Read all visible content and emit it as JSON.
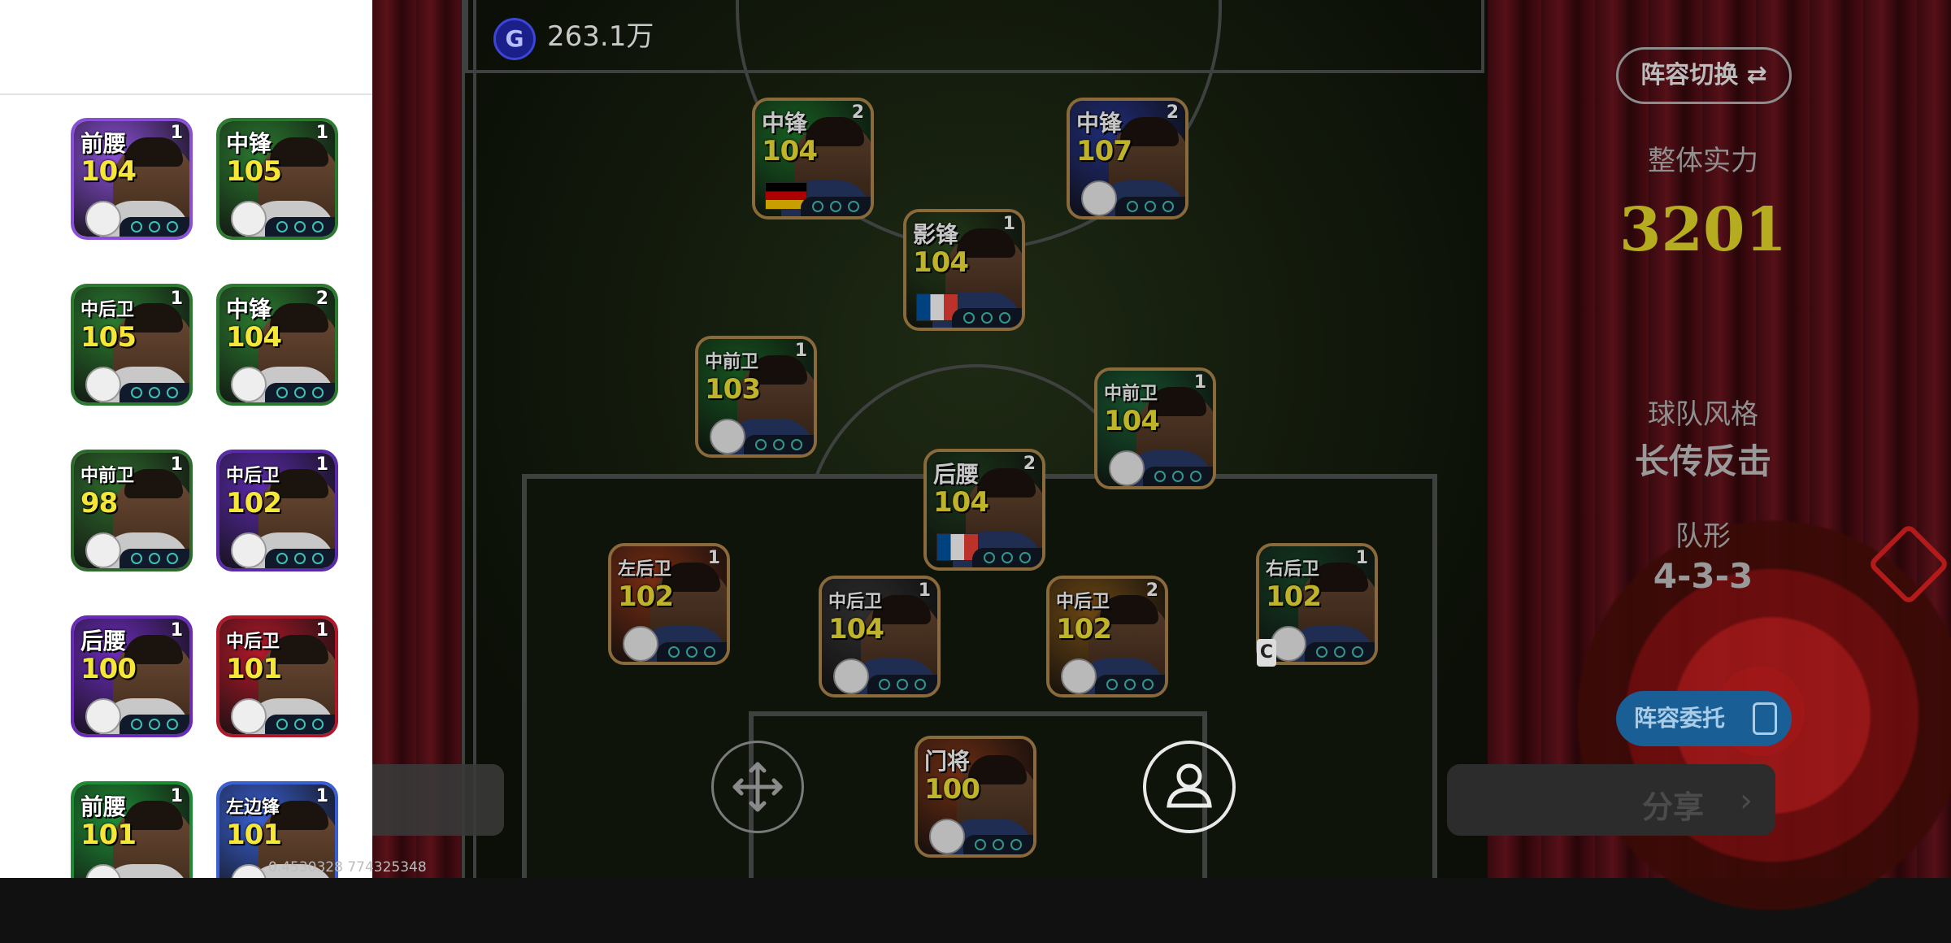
{
  "currency": {
    "icon": "G",
    "value": "263.1万"
  },
  "right_panel": {
    "lineup_switch": "阵容切换 ⇄",
    "strength_label": "整体实力",
    "strength_value": "3201",
    "style_label": "球队风格",
    "style_value": "长传反击",
    "formation_label": "队形",
    "formation_value": "4-3-3",
    "delegate_button": "阵容委托",
    "share_button": "分享",
    "share_chevron": "›"
  },
  "coords_text": "0.4530328   774325348",
  "bench": [
    {
      "pos": "前腰",
      "rating": "104",
      "num": "1",
      "theme": "#8a4fd6"
    },
    {
      "pos": "中锋",
      "rating": "105",
      "num": "1",
      "theme": "#2b7a2f"
    },
    {
      "pos": "中后卫",
      "rating": "105",
      "num": "1",
      "theme": "#2b7a2f"
    },
    {
      "pos": "中锋",
      "rating": "104",
      "num": "2",
      "theme": "#2b7a2f"
    },
    {
      "pos": "中前卫",
      "rating": "98",
      "num": "1",
      "theme": "#2e6a2c"
    },
    {
      "pos": "中后卫",
      "rating": "102",
      "num": "1",
      "theme": "#5a2aa8"
    },
    {
      "pos": "后腰",
      "rating": "100",
      "num": "1",
      "theme": "#6a2bb8"
    },
    {
      "pos": "中后卫",
      "rating": "101",
      "num": "1",
      "theme": "#b0182a"
    },
    {
      "pos": "前腰",
      "rating": "101",
      "num": "1",
      "theme": "#1f8a35"
    },
    {
      "pos": "左边锋",
      "rating": "101",
      "num": "1",
      "theme": "#3a5fd0"
    }
  ],
  "pitch_players": [
    {
      "pos": "中锋",
      "rating": "104",
      "num": "2",
      "theme": "#1f7a2c"
    },
    {
      "pos": "中锋",
      "rating": "107",
      "num": "2",
      "theme": "#2a3a9a"
    },
    {
      "pos": "影锋",
      "rating": "104",
      "num": "1",
      "theme": "#2b4a1e"
    },
    {
      "pos": "中前卫",
      "rating": "103",
      "num": "1",
      "theme": "#1d6a28"
    },
    {
      "pos": "中前卫",
      "rating": "104",
      "num": "1",
      "theme": "#1d6a3a"
    },
    {
      "pos": "后腰",
      "rating": "104",
      "num": "2",
      "theme": "#224422"
    },
    {
      "pos": "左后卫",
      "rating": "102",
      "num": "1",
      "theme": "#9a3a1a"
    },
    {
      "pos": "中后卫",
      "rating": "104",
      "num": "1",
      "theme": "#3a3a3a"
    },
    {
      "pos": "中后卫",
      "rating": "102",
      "num": "2",
      "theme": "#8a5a1a"
    },
    {
      "pos": "右后卫",
      "rating": "102",
      "num": "1",
      "theme": "#1a4a2a"
    },
    {
      "pos": "门将",
      "rating": "100",
      "num": "",
      "theme": "#8a3a1a"
    }
  ],
  "captain_badge": "C"
}
